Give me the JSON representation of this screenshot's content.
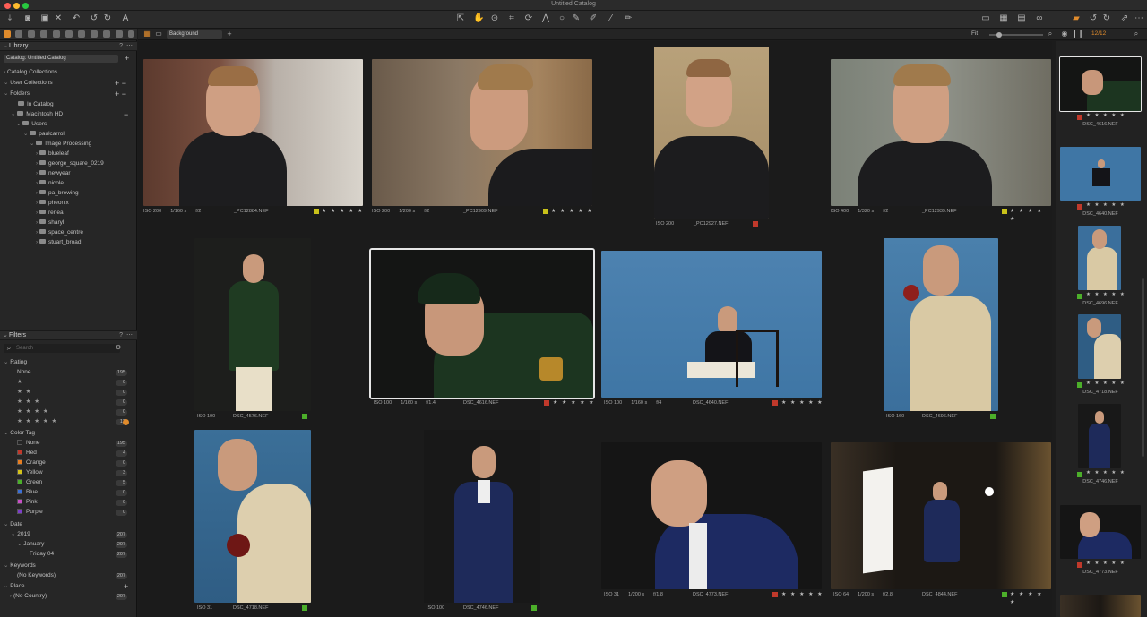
{
  "window": {
    "title": "Untitled Catalog"
  },
  "viewer": {
    "background_mode": "Background",
    "fit_label": "Fit",
    "count": "12/12"
  },
  "library": {
    "header": "Library",
    "catalog": "Catalog: Untitled Catalog",
    "catalog_collections": "Catalog Collections",
    "user_collections": "User Collections",
    "folders": "Folders",
    "tree": [
      {
        "label": "In Catalog"
      },
      {
        "label": "Macintosh HD"
      },
      {
        "label": "Users"
      },
      {
        "label": "paulcarroll"
      },
      {
        "label": "Image Processing"
      },
      {
        "label": "blueleaf"
      },
      {
        "label": "george_square_0219"
      },
      {
        "label": "newyear"
      },
      {
        "label": "nicole"
      },
      {
        "label": "pa_brewing"
      },
      {
        "label": "pheonix"
      },
      {
        "label": "renea"
      },
      {
        "label": "sharyl"
      },
      {
        "label": "space_centre"
      },
      {
        "label": "stuart_broad"
      }
    ]
  },
  "filters": {
    "header": "Filters",
    "search_placeholder": "Search",
    "rating_header": "Rating",
    "rating": [
      {
        "label": "None",
        "count": "195"
      },
      {
        "label": "★",
        "count": "0"
      },
      {
        "label": "★ ★",
        "count": "0"
      },
      {
        "label": "★ ★ ★",
        "count": "0"
      },
      {
        "label": "★ ★ ★ ★",
        "count": "0"
      },
      {
        "label": "★ ★ ★ ★ ★",
        "count": "12"
      }
    ],
    "color_header": "Color Tag",
    "colors": [
      {
        "label": "None",
        "count": "195",
        "color": "#262626"
      },
      {
        "label": "Red",
        "count": "4",
        "color": "#c0392b"
      },
      {
        "label": "Orange",
        "count": "0",
        "color": "#e67e22"
      },
      {
        "label": "Yellow",
        "count": "3",
        "color": "#d4c21a"
      },
      {
        "label": "Green",
        "count": "5",
        "color": "#4caf2a"
      },
      {
        "label": "Blue",
        "count": "0",
        "color": "#3b6fd6"
      },
      {
        "label": "Pink",
        "count": "0",
        "color": "#c84fc8"
      },
      {
        "label": "Purple",
        "count": "0",
        "color": "#7d3ec9"
      }
    ],
    "date_header": "Date",
    "dates": [
      {
        "label": "2019",
        "count": "207"
      },
      {
        "label": "January",
        "count": "207"
      },
      {
        "label": "Friday 04",
        "count": "207"
      }
    ],
    "keywords_header": "Keywords",
    "keywords": [
      {
        "label": "(No Keywords)",
        "count": "207"
      }
    ],
    "place_header": "Place",
    "places": [
      {
        "label": "(No Country)",
        "count": "207"
      }
    ]
  },
  "photos": [
    {
      "iso": "ISO 200",
      "shutter": "1/160 s",
      "aperture": "f/2",
      "file": "_PC12884.NEF",
      "tag": "#c9c21a",
      "stars": "★ ★ ★ ★ ★"
    },
    {
      "iso": "ISO 200",
      "shutter": "1/200 s",
      "aperture": "f/2",
      "file": "_PC12909.NEF",
      "tag": "#c9c21a",
      "stars": "★ ★ ★ ★ ★"
    },
    {
      "iso": "ISO 200",
      "shutter": "",
      "aperture": "",
      "file": "_PC12927.NEF",
      "tag": "#c0392b",
      "stars": ""
    },
    {
      "iso": "ISO 400",
      "shutter": "1/320 s",
      "aperture": "f/2",
      "file": "_PC12939.NEF",
      "tag": "#c9c21a",
      "stars": "★ ★ ★ ★ ★"
    },
    {
      "iso": "ISO 100",
      "shutter": "",
      "aperture": "",
      "file": "DSC_4576.NEF",
      "tag": "#4caf2a",
      "stars": ""
    },
    {
      "iso": "ISO 100",
      "shutter": "1/160 s",
      "aperture": "f/1.4",
      "file": "DSC_4616.NEF",
      "tag": "#c0392b",
      "stars": "★ ★ ★ ★ ★"
    },
    {
      "iso": "ISO 100",
      "shutter": "1/160 s",
      "aperture": "f/4",
      "file": "DSC_4640.NEF",
      "tag": "#c0392b",
      "stars": "★ ★ ★ ★ ★"
    },
    {
      "iso": "ISO 160",
      "shutter": "",
      "aperture": "",
      "file": "DSC_4696.NEF",
      "tag": "#4caf2a",
      "stars": ""
    },
    {
      "iso": "ISO 31",
      "shutter": "",
      "aperture": "",
      "file": "DSC_4718.NEF",
      "tag": "#4caf2a",
      "stars": ""
    },
    {
      "iso": "ISO 100",
      "shutter": "",
      "aperture": "",
      "file": "DSC_4746.NEF",
      "tag": "#4caf2a",
      "stars": ""
    },
    {
      "iso": "ISO 31",
      "shutter": "1/200 s",
      "aperture": "f/1.8",
      "file": "DSC_4773.NEF",
      "tag": "#c0392b",
      "stars": "★ ★ ★ ★ ★"
    },
    {
      "iso": "ISO 64",
      "shutter": "1/200 s",
      "aperture": "f/2.8",
      "file": "DSC_4844.NEF",
      "tag": "#4caf2a",
      "stars": "★ ★ ★ ★ ★"
    }
  ],
  "filmstrip": [
    {
      "file": "DSC_4616.NEF",
      "tag": "#c0392b",
      "stars": "★ ★ ★ ★ ★"
    },
    {
      "file": "DSC_4640.NEF",
      "tag": "#c0392b",
      "stars": "★ ★ ★ ★ ★"
    },
    {
      "file": "DSC_4696.NEF",
      "tag": "#4caf2a",
      "stars": "★ ★ ★ ★ ★"
    },
    {
      "file": "DSC_4718.NEF",
      "tag": "#4caf2a",
      "stars": "★ ★ ★ ★ ★"
    },
    {
      "file": "DSC_4746.NEF",
      "tag": "#4caf2a",
      "stars": "★ ★ ★ ★ ★"
    },
    {
      "file": "DSC_4773.NEF",
      "tag": "#c0392b",
      "stars": "★ ★ ★ ★ ★"
    }
  ]
}
